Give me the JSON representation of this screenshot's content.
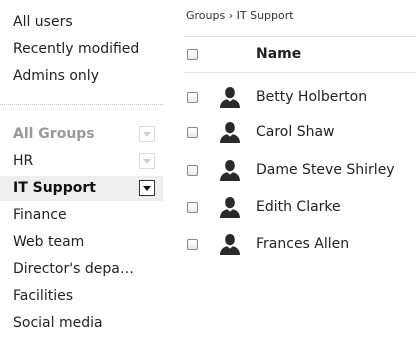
{
  "sidebar": {
    "quick_filters": [
      "All users",
      "Recently modified",
      "Admins only"
    ],
    "groups": [
      {
        "label": "All Groups",
        "has_dropdown": true
      },
      {
        "label": "HR",
        "has_dropdown": true
      },
      {
        "label": "IT Support",
        "has_dropdown": true,
        "selected": true
      },
      {
        "label": "Finance",
        "has_dropdown": false
      },
      {
        "label": "Web team",
        "has_dropdown": false
      },
      {
        "label": "Director's departme",
        "has_dropdown": false
      },
      {
        "label": "Facilities",
        "has_dropdown": false
      },
      {
        "label": "Social media",
        "has_dropdown": false
      }
    ]
  },
  "breadcrumb": {
    "parent": "Groups",
    "separator": "›",
    "current": "IT Support"
  },
  "table": {
    "name_header": "Name",
    "users": [
      {
        "name": "Betty Holberton",
        "icon": "user-icon"
      },
      {
        "name": "Carol Shaw",
        "icon": "user-icon"
      },
      {
        "name": "Dame Steve Shirley",
        "icon": "user-icon"
      },
      {
        "name": "Edith Clarke",
        "icon": "user-icon"
      },
      {
        "name": "Frances Allen",
        "icon": "user-icon"
      }
    ]
  },
  "colors": {
    "selected_row": "#eeeeee",
    "muted_heading": "#999999",
    "avatar": "#2a2a2a"
  }
}
